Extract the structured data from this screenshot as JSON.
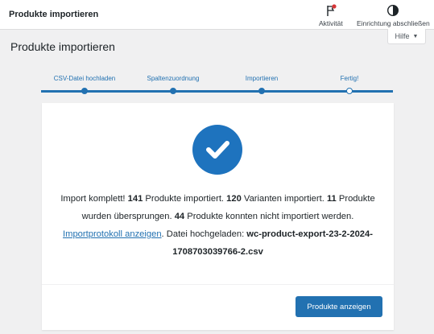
{
  "topbar": {
    "title": "Produkte importieren",
    "activity_label": "Aktivität",
    "setup_label": "Einrichtung abschließen",
    "activity_icon": "flag-icon",
    "setup_icon": "half-circle-icon"
  },
  "help": {
    "label": "Hilfe"
  },
  "page": {
    "title": "Produkte importieren"
  },
  "steps": [
    {
      "label": "CSV-Datei hochladen",
      "state": "done"
    },
    {
      "label": "Spaltenzuordnung",
      "state": "done"
    },
    {
      "label": "Importieren",
      "state": "done"
    },
    {
      "label": "Fertig!",
      "state": "current"
    }
  ],
  "result": {
    "icon": "checkmark-icon",
    "t1": "Import komplett! ",
    "imported": "141",
    "t2": " Produkte importiert. ",
    "variants": "120",
    "t3": " Varianten importiert. ",
    "skipped": "11",
    "t4": " Produkte wurden übersprungen. ",
    "failed": "44",
    "t5": " Produkte konnten nicht importiert werden. ",
    "log_link": "Importprotokoll anzeigen",
    "t6": ". Datei hochgeladen: ",
    "filename": "wc-product-export-23-2-2024-1708703039766-2.csv"
  },
  "actions": {
    "view_products": "Produkte anzeigen"
  },
  "colors": {
    "accent": "#2271b1",
    "check_bg": "#1e73be",
    "badge_red": "#d63638"
  }
}
